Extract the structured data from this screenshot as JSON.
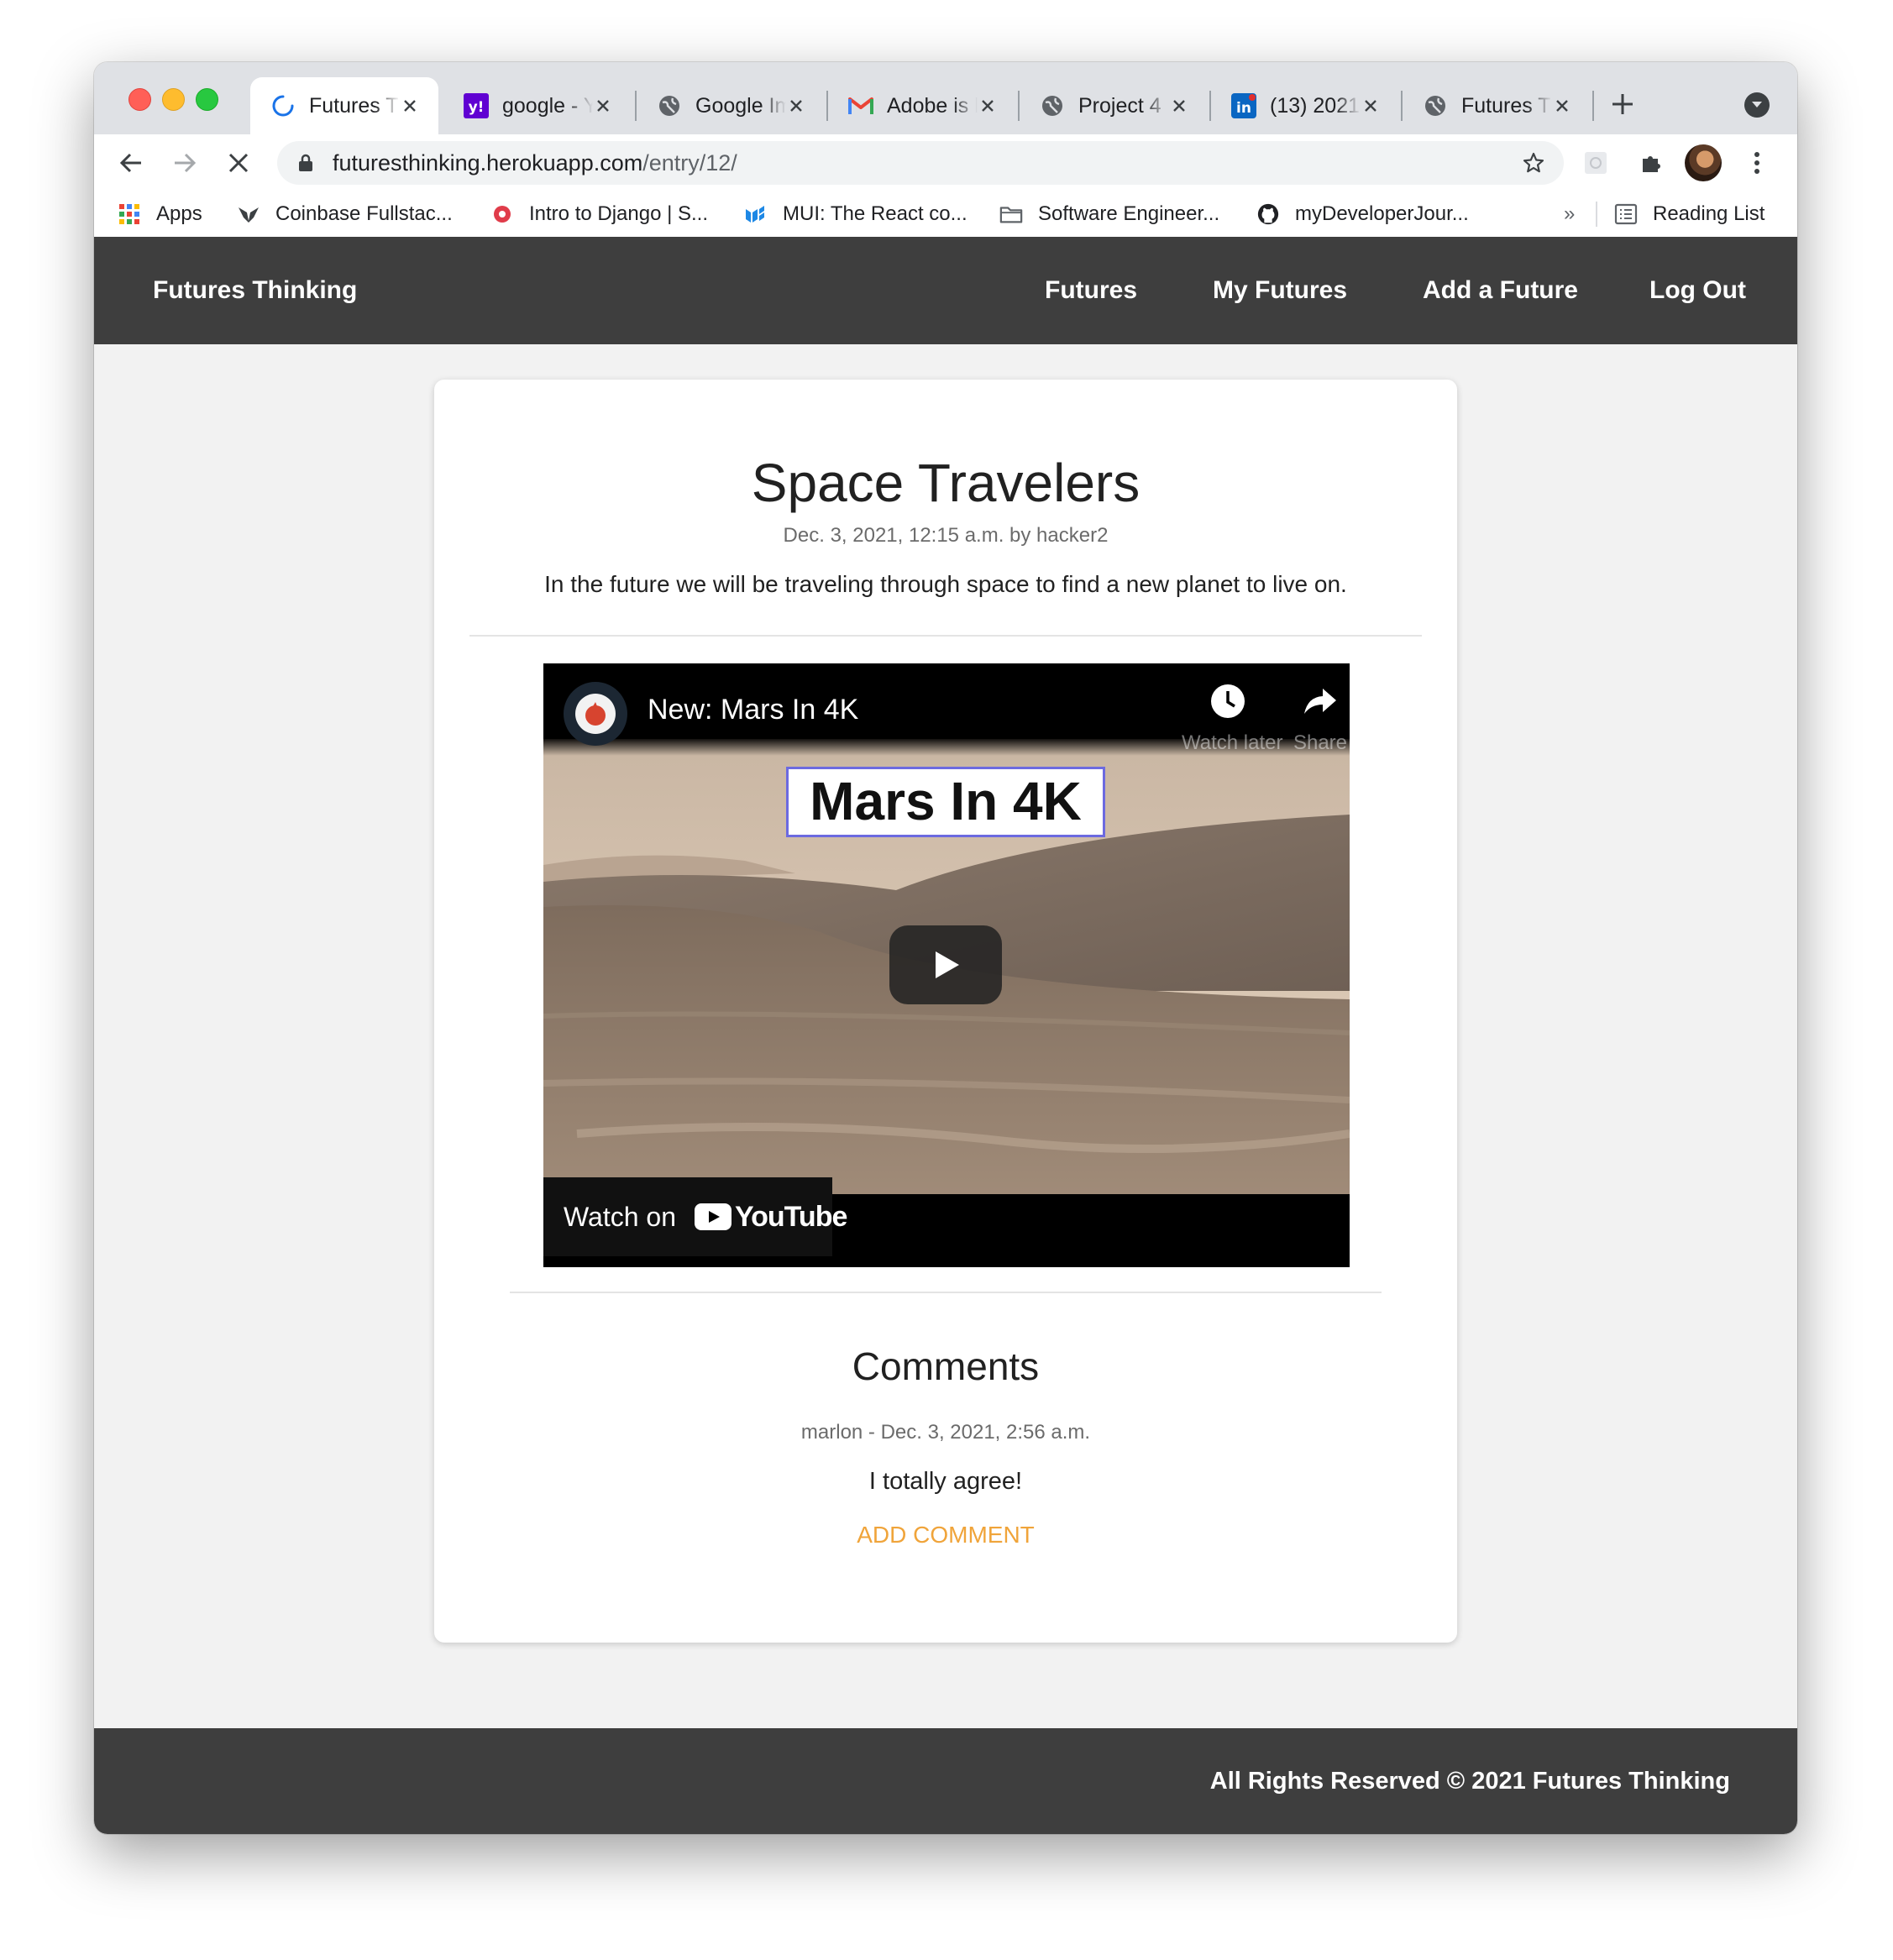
{
  "browser": {
    "tabs": [
      {
        "title": "Futures Thinking",
        "icon": "loading-spinner-icon"
      },
      {
        "title": "google - Yahoo Search",
        "icon": "yahoo-icon"
      },
      {
        "title": "Google Images",
        "icon": "globe-icon"
      },
      {
        "title": "Adobe is hiring",
        "icon": "gmail-icon"
      },
      {
        "title": "Project 4",
        "icon": "globe-icon"
      },
      {
        "title": "(13) 2021",
        "icon": "linkedin-icon"
      },
      {
        "title": "Futures Thinking",
        "icon": "globe-icon"
      }
    ],
    "url_domain": "futuresthinking.herokuapp.com",
    "url_path": "/entry/12/",
    "bookmarks": [
      {
        "label": "Apps",
        "icon": "apps-grid-icon"
      },
      {
        "label": "Coinbase Fullstac...",
        "icon": "coinbase-fox-icon"
      },
      {
        "label": "Intro to Django | S...",
        "icon": "django-icon"
      },
      {
        "label": "MUI: The React co...",
        "icon": "mui-icon"
      },
      {
        "label": "Software Engineer...",
        "icon": "folder-icon"
      },
      {
        "label": "myDeveloperJour...",
        "icon": "github-icon"
      }
    ],
    "more_bookmarks": "»",
    "reading_list": "Reading List"
  },
  "site": {
    "brand": "Futures Thinking",
    "nav": [
      "Futures",
      "My Futures",
      "Add a Future",
      "Log Out"
    ],
    "footer": "All Rights Reserved © 2021 Futures Thinking"
  },
  "entry": {
    "title": "Space Travelers",
    "meta": "Dec. 3, 2021, 12:15 a.m. by hacker2",
    "description": "In the future we will be traveling through space to find a new planet to live on."
  },
  "video": {
    "title": "New: Mars In 4K",
    "overlay_text": "Mars In 4K",
    "watch_later": "Watch later",
    "share": "Share",
    "watch_on": "Watch on",
    "youtube": "YouTube"
  },
  "comments": {
    "heading": "Comments",
    "items": [
      {
        "meta": "marlon - Dec. 3, 2021, 2:56 a.m.",
        "text": "I totally agree!"
      }
    ],
    "add_label": "ADD COMMENT"
  },
  "colors": {
    "navbar": "#3e3e3e",
    "page_bg": "#f2f2f2",
    "accent": "#f0a43a"
  }
}
